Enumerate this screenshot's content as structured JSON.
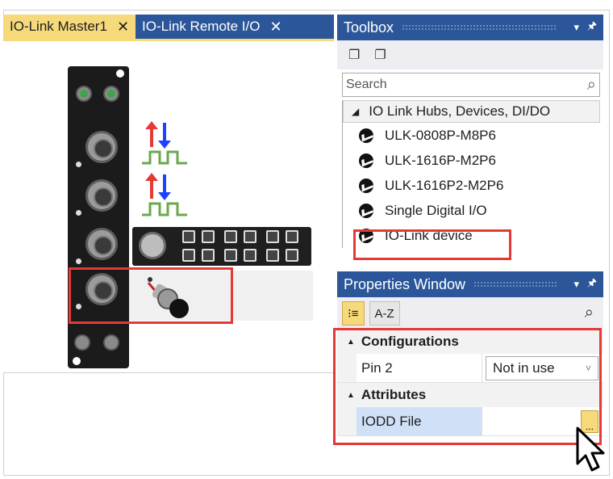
{
  "tabs": [
    {
      "label": "IO-Link Master1",
      "close": "✕",
      "active": true
    },
    {
      "label": "IO-Link Remote I/O",
      "close": "✕",
      "active": false
    }
  ],
  "toolbox": {
    "title": "Toolbox",
    "pin": "▾",
    "pin2": "🖈",
    "search_placeholder": "Search",
    "group": "IO Link Hubs, Devices, DI/DO",
    "items": [
      {
        "label": "ULK-0808P-M8P6"
      },
      {
        "label": "ULK-1616P-M2P6"
      },
      {
        "label": "ULK-1616P2-M2P6"
      },
      {
        "label": "Single Digital I/O"
      },
      {
        "label": "IO-Link device"
      }
    ]
  },
  "properties": {
    "title": "Properties Window",
    "pin": "▾",
    "pin2": "🖈",
    "sort_categorized": "⁝≡",
    "sort_alpha": "A-Z",
    "categories": [
      {
        "name": "Configurations",
        "rows": [
          {
            "name": "Pin 2",
            "value": "Not in use"
          }
        ]
      },
      {
        "name": "Attributes",
        "rows": [
          {
            "name": "IODD File",
            "value": ""
          }
        ]
      }
    ],
    "ellipsis": "..."
  },
  "colors": {
    "accent": "#2b579a",
    "tab_active": "#f6d97a",
    "highlight": "#e53935",
    "signal_up": "#e53935",
    "signal_down": "#1e40ff",
    "signal_wave": "#6aa84f"
  }
}
